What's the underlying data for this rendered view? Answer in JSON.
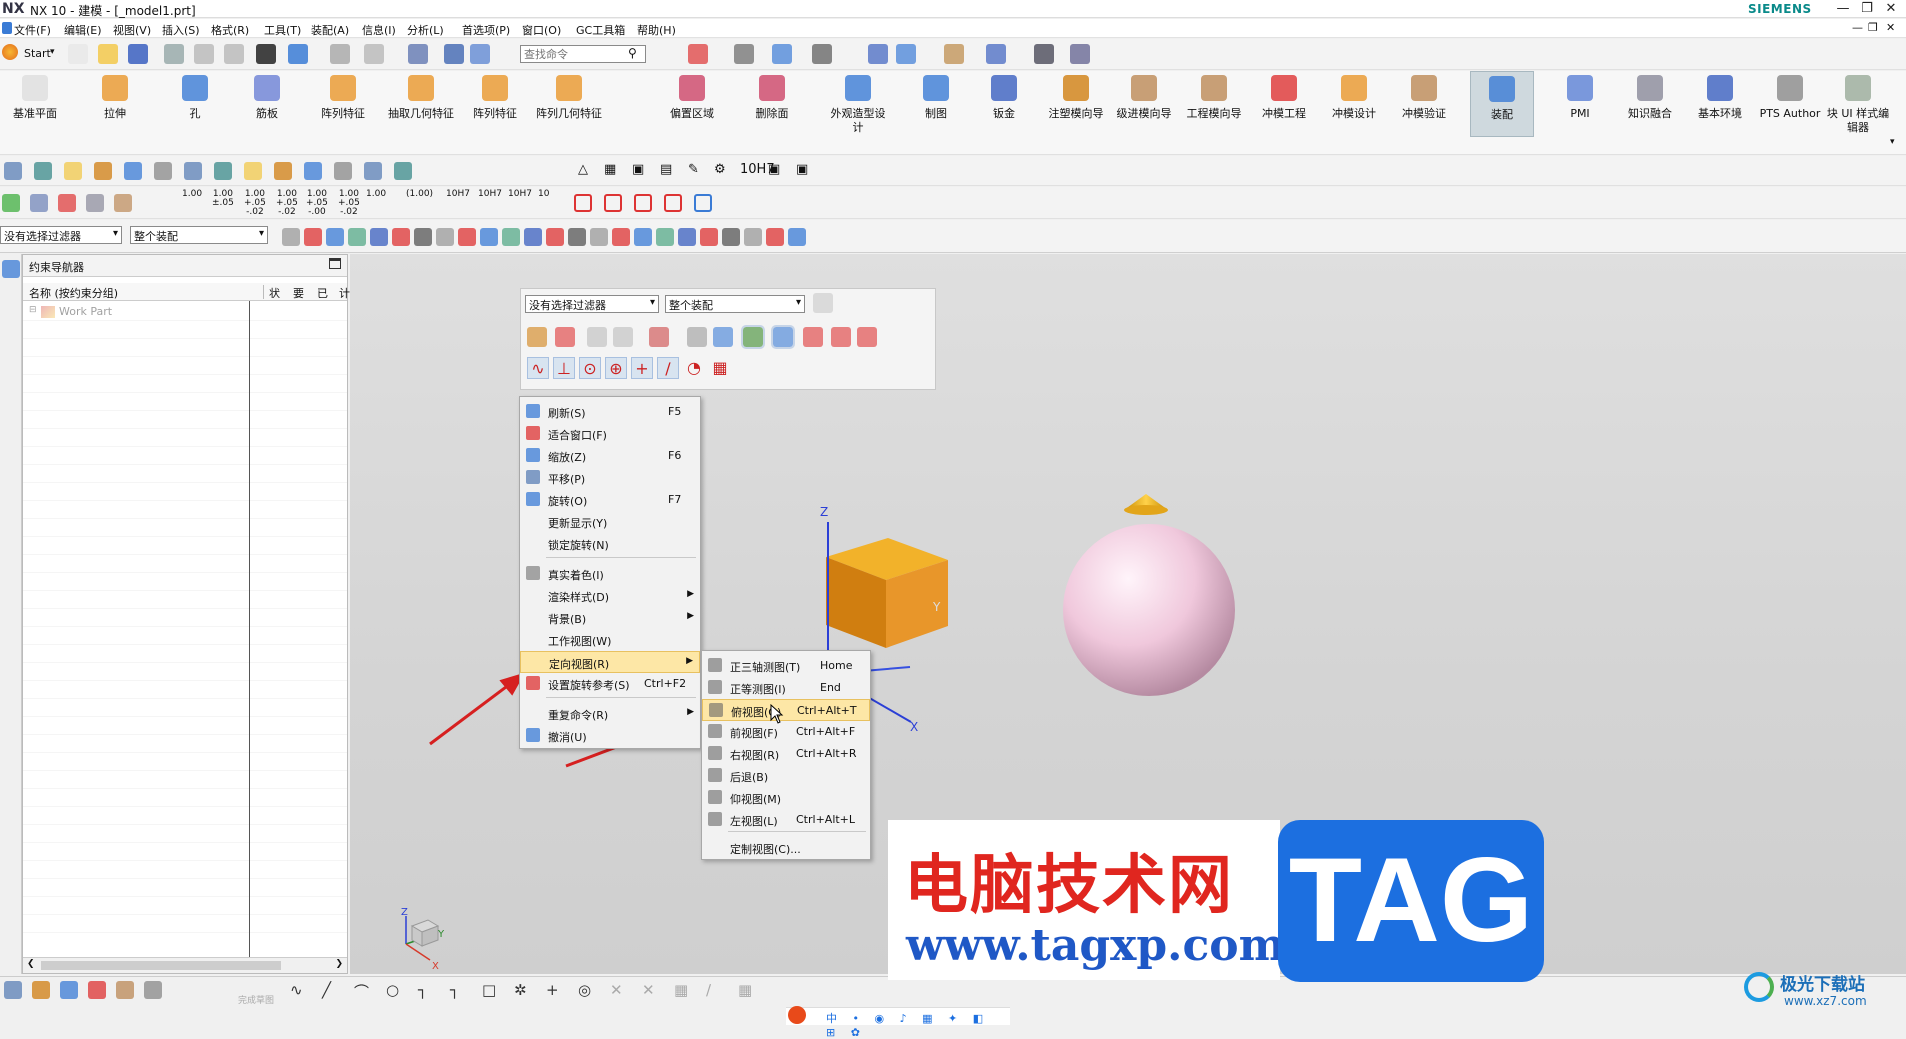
{
  "app": {
    "logo": "NX",
    "title": "NX 10 - 建模 - [_model1.prt]",
    "brand": "SIEMENS"
  },
  "menubar": [
    "文件(F)",
    "编辑(E)",
    "视图(V)",
    "插入(S)",
    "格式(R)",
    "工具(T)",
    "装配(A)",
    "信息(I)",
    "分析(L)",
    "首选项(P)",
    "窗口(O)",
    "GC工具箱",
    "帮助(H)"
  ],
  "toolbar": {
    "start_label": "Start",
    "search_placeholder": "查找命令"
  },
  "ribbon": [
    {
      "label": "基准平面",
      "icon": "datum-plane-icon"
    },
    {
      "label": "拉伸",
      "icon": "extrude-icon"
    },
    {
      "label": "孔",
      "icon": "hole-icon"
    },
    {
      "label": "筋板",
      "icon": "rib-icon"
    },
    {
      "label": "阵列特征",
      "icon": "pattern-feature-icon"
    },
    {
      "label": "抽取几何特征",
      "icon": "extract-geometry-icon"
    },
    {
      "label": "阵列特征",
      "icon": "pattern-feature-icon"
    },
    {
      "label": "阵列几何特征",
      "icon": "pattern-geometry-icon"
    },
    {
      "label": "偏置区域",
      "icon": "offset-region-icon"
    },
    {
      "label": "删除面",
      "icon": "delete-face-icon"
    },
    {
      "label": "外观造型设计",
      "icon": "shape-studio-icon"
    },
    {
      "label": "制图",
      "icon": "drafting-icon"
    },
    {
      "label": "钣金",
      "icon": "sheet-metal-icon"
    },
    {
      "label": "注塑模向导",
      "icon": "mold-wizard-icon"
    },
    {
      "label": "级进模向导",
      "icon": "progressive-die-icon"
    },
    {
      "label": "工程模向导",
      "icon": "engineering-die-icon"
    },
    {
      "label": "冲模工程",
      "icon": "die-engineering-icon"
    },
    {
      "label": "冲模设计",
      "icon": "die-design-icon"
    },
    {
      "label": "冲模验证",
      "icon": "die-validation-icon"
    },
    {
      "label": "装配",
      "icon": "assembly-icon",
      "active": true
    },
    {
      "label": "PMI",
      "icon": "pmi-icon"
    },
    {
      "label": "知识融合",
      "icon": "knowledge-fusion-icon"
    },
    {
      "label": "基本环境",
      "icon": "basic-environment-icon"
    },
    {
      "label": "PTS Author",
      "icon": "pts-author-icon"
    },
    {
      "label": "块 UI 样式编辑器",
      "icon": "block-ui-styler-icon"
    }
  ],
  "pmi_bar": {
    "values": [
      "1.00",
      "1.00\n±.05",
      "1.00\n+.05\n-.02",
      "1.00\n+.05\n-.02",
      "1.00\n+.05\n-.00",
      "1.00\n+.05\n-.02",
      "1.00",
      "(1.00)",
      "10H7",
      "10H7",
      "10H7",
      "10"
    ]
  },
  "selection_bar": {
    "filter": "没有选择过滤器",
    "scope": "整个装配"
  },
  "navigator": {
    "title": "约束导航器",
    "columns": [
      "名称 (按约束分组)",
      "状",
      "要",
      "已",
      "计"
    ],
    "rows": [
      {
        "label": "Work Part"
      }
    ]
  },
  "float_bar": {
    "filter": "没有选择过滤器",
    "scope": "整个装配"
  },
  "context_menu": {
    "items": [
      {
        "label": "刷新(S)",
        "shortcut": "F5",
        "icon": "refresh-icon"
      },
      {
        "label": "适合窗口(F)",
        "shortcut": "",
        "icon": "fit-window-icon"
      },
      {
        "label": "缩放(Z)",
        "shortcut": "F6",
        "icon": "zoom-icon"
      },
      {
        "label": "平移(P)",
        "shortcut": "",
        "icon": "pan-icon"
      },
      {
        "label": "旋转(O)",
        "shortcut": "F7",
        "icon": "rotate-icon"
      },
      {
        "label": "更新显示(Y)",
        "shortcut": "",
        "icon": ""
      },
      {
        "label": "锁定旋转(N)",
        "shortcut": "",
        "icon": ""
      },
      {
        "label": "真实着色(I)",
        "shortcut": "",
        "icon": "true-shading-icon"
      },
      {
        "label": "渲染样式(D)",
        "shortcut": "",
        "icon": "",
        "submenu": true
      },
      {
        "label": "背景(B)",
        "shortcut": "",
        "icon": "",
        "submenu": true
      },
      {
        "label": "工作视图(W)",
        "shortcut": "",
        "icon": ""
      },
      {
        "label": "定向视图(R)",
        "shortcut": "",
        "icon": "",
        "submenu": true,
        "highlighted": true
      },
      {
        "label": "设置旋转参考(S)",
        "shortcut": "Ctrl+F2",
        "icon": "rotation-ref-icon"
      },
      {
        "label": "重复命令(R)",
        "shortcut": "",
        "icon": "",
        "submenu": true
      },
      {
        "label": "撤消(U)",
        "shortcut": "",
        "icon": "undo-icon"
      }
    ]
  },
  "orient_submenu": {
    "items": [
      {
        "label": "正三轴测图(T)",
        "shortcut": "Home",
        "icon": "trimetric-icon"
      },
      {
        "label": "正等测图(I)",
        "shortcut": "End",
        "icon": "isometric-icon"
      },
      {
        "label": "俯视图(O)",
        "shortcut": "Ctrl+Alt+T",
        "icon": "top-view-icon",
        "highlighted": true
      },
      {
        "label": "前视图(F)",
        "shortcut": "Ctrl+Alt+F",
        "icon": "front-view-icon"
      },
      {
        "label": "右视图(R)",
        "shortcut": "Ctrl+Alt+R",
        "icon": "right-view-icon"
      },
      {
        "label": "后退(B)",
        "shortcut": "",
        "icon": "back-view-icon"
      },
      {
        "label": "仰视图(M)",
        "shortcut": "",
        "icon": "bottom-view-icon"
      },
      {
        "label": "左视图(L)",
        "shortcut": "Ctrl+Alt+L",
        "icon": "left-view-icon"
      },
      {
        "label": "定制视图(C)...",
        "shortcut": "",
        "icon": ""
      }
    ]
  },
  "viewport": {
    "axis_labels": {
      "z": "Z",
      "y": "Y",
      "x": "X"
    },
    "triad": {
      "z": "Z",
      "y": "Y",
      "x": "X"
    },
    "sketch_label": "完成草图"
  },
  "watermark": {
    "cn_title": "电脑技术网",
    "url": "www.tagxp.com",
    "tag": "TAG",
    "corner": "极光下载站",
    "corner_url": "www.xz7.com"
  },
  "colors": {
    "cube": "#e89a1c",
    "sphere": "#f0c8dc",
    "highlight": "#fde7a6",
    "watermark_red": "#e0261f",
    "watermark_blue": "#1c6fe0"
  }
}
